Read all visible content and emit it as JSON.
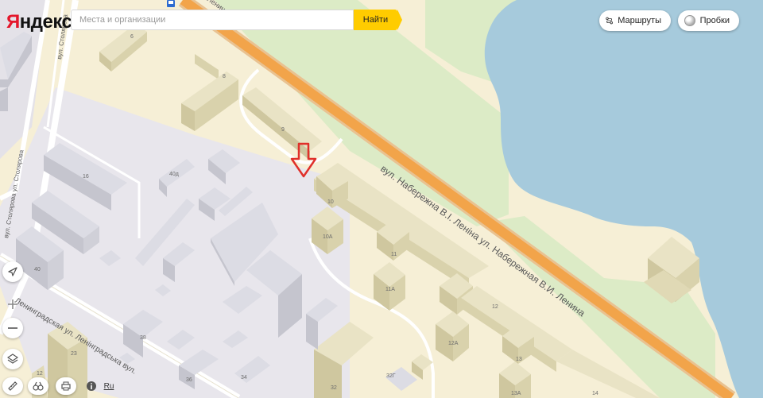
{
  "logo": {
    "first_letter": "Я",
    "rest": "ндекс"
  },
  "search": {
    "placeholder": "Места и организации",
    "button_label": "Найти"
  },
  "top_right": {
    "routes_label": "Маршруты",
    "traffic_label": "Пробки"
  },
  "colors": {
    "water": "#a6cadc",
    "land": "#f6efd6",
    "park": "#dcebc6",
    "road": "#f2a44a",
    "building": "#e9e3c5",
    "industrial": "#dcdce4",
    "brand_red": "#e4172b",
    "button_yellow": "#ffcc00",
    "marker": "#e0302a"
  },
  "map": {
    "house_numbers": [
      "6",
      "8",
      "9",
      "10",
      "10А",
      "11",
      "11А",
      "12",
      "12А",
      "13",
      "13А",
      "14",
      "16",
      "40д",
      "40",
      "38",
      "36",
      "34",
      "32Г",
      "32",
      "23",
      "12",
      "29"
    ],
    "street_labels": {
      "embankment": "вул. Набережна В.І. Леніна ул. Набережная В.И. Ленина",
      "leningradskaya": "Ленинградская ул. Ленінградська вул.",
      "stolyarova": "вул. Столярова ул. Столярова",
      "stolyarova_top": "вул. Столярова",
      "lenina_top": "Ленина"
    },
    "bus_stop_icon": "bus-stop-icon",
    "marker_icon": "red-arrow-marker-icon"
  },
  "controls": {
    "locate_icon": "locate-arrow-icon",
    "zoom_in_icon": "plus-icon",
    "zoom_out_icon": "minus-icon",
    "layers_icon": "layers-icon",
    "ruler_icon": "ruler-icon",
    "panorama_icon": "binoculars-icon",
    "print_icon": "printer-icon",
    "info_icon": "info-icon",
    "lang_label": "Ru"
  }
}
